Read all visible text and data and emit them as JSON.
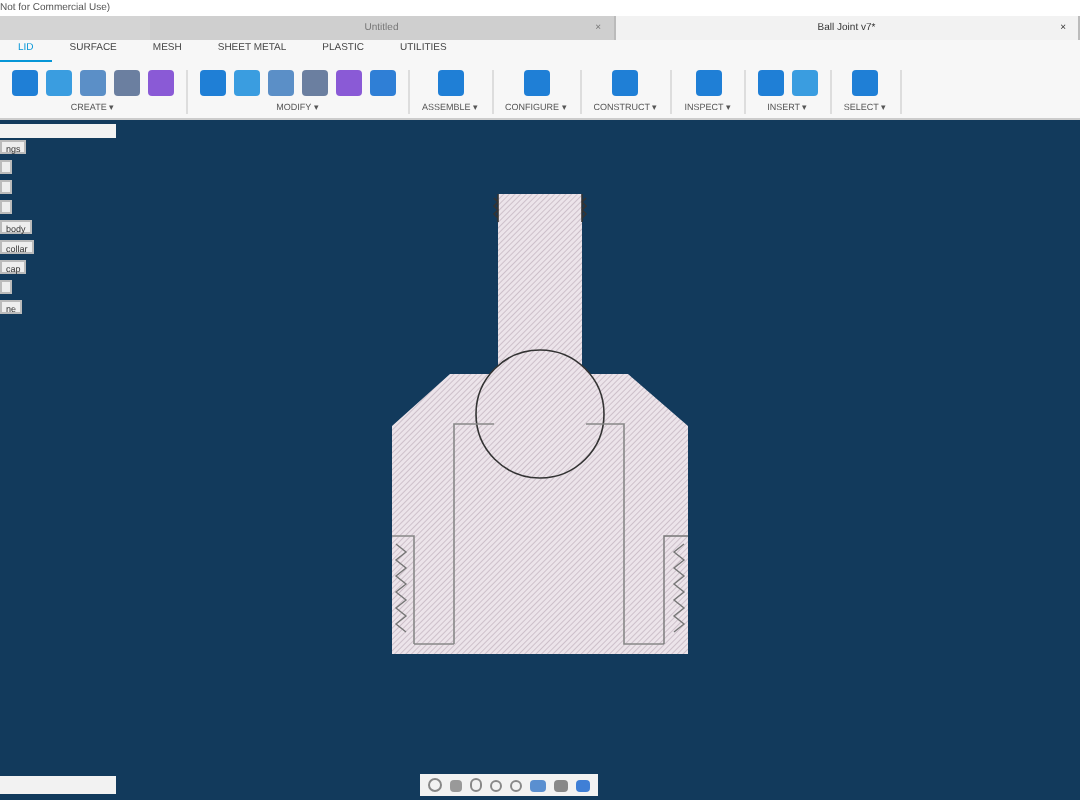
{
  "window": {
    "title": "Not for Commercial Use)"
  },
  "document_tabs": [
    {
      "label": "Untitled",
      "close": "×",
      "selected": false
    },
    {
      "label": "Ball Joint v7*",
      "close": "×",
      "selected": true
    }
  ],
  "toolbar_tabs": [
    {
      "label": "LID",
      "selected": true
    },
    {
      "label": "SURFACE",
      "selected": false
    },
    {
      "label": "MESH",
      "selected": false
    },
    {
      "label": "SHEET METAL",
      "selected": false
    },
    {
      "label": "PLASTIC",
      "selected": false
    },
    {
      "label": "UTILITIES",
      "selected": false
    }
  ],
  "toolbar_groups": [
    {
      "label": "CREATE ▾"
    },
    {
      "label": "MODIFY ▾"
    },
    {
      "label": "ASSEMBLE ▾"
    },
    {
      "label": "CONFIGURE ▾"
    },
    {
      "label": "CONSTRUCT ▾"
    },
    {
      "label": "INSPECT ▾"
    },
    {
      "label": "INSERT ▾"
    },
    {
      "label": "SELECT ▾"
    }
  ],
  "browser_items": [
    {
      "kind": "labeled",
      "label": "ngs"
    },
    {
      "kind": "blank"
    },
    {
      "kind": "blank"
    },
    {
      "kind": "blank"
    },
    {
      "kind": "labeled",
      "label": "body"
    },
    {
      "kind": "labeled",
      "label": "collar"
    },
    {
      "kind": "labeled",
      "label": "cap"
    },
    {
      "kind": "blank"
    },
    {
      "kind": "labeled",
      "label": "ne"
    }
  ]
}
